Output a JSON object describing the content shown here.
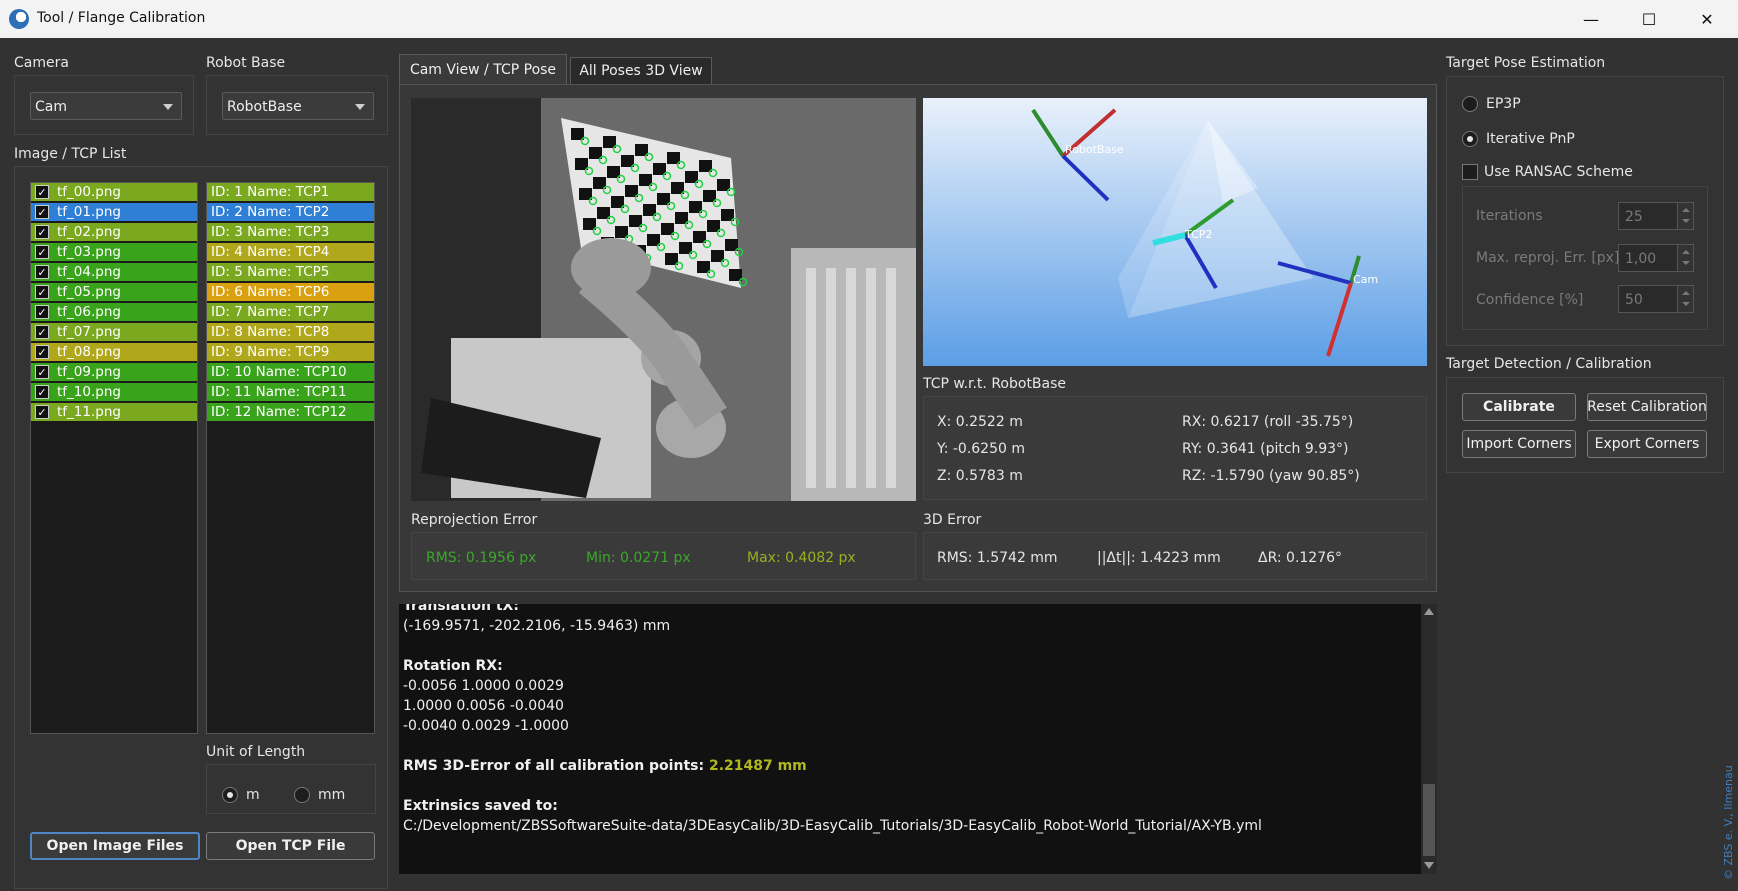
{
  "window": {
    "title": "Tool / Flange Calibration",
    "minimize": "—",
    "maximize": "☐",
    "close": "✕"
  },
  "camera": {
    "label": "Camera",
    "value": "Cam"
  },
  "robot_base": {
    "label": "Robot Base",
    "value": "RobotBase"
  },
  "image_list": {
    "label": "Image / TCP List",
    "images": [
      {
        "name": "tf_00.png",
        "checked": true,
        "color": "#7aa81e"
      },
      {
        "name": "tf_01.png",
        "checked": true,
        "color": "#2f7fd6"
      },
      {
        "name": "tf_02.png",
        "checked": true,
        "color": "#7aa81e"
      },
      {
        "name": "tf_03.png",
        "checked": true,
        "color": "#3aa31c"
      },
      {
        "name": "tf_04.png",
        "checked": true,
        "color": "#3aa31c"
      },
      {
        "name": "tf_05.png",
        "checked": true,
        "color": "#3aa31c"
      },
      {
        "name": "tf_06.png",
        "checked": true,
        "color": "#3aa31c"
      },
      {
        "name": "tf_07.png",
        "checked": true,
        "color": "#7aa81e"
      },
      {
        "name": "tf_08.png",
        "checked": true,
        "color": "#b0a81a"
      },
      {
        "name": "tf_09.png",
        "checked": true,
        "color": "#3aa31c"
      },
      {
        "name": "tf_10.png",
        "checked": true,
        "color": "#3aa31c"
      },
      {
        "name": "tf_11.png",
        "checked": true,
        "color": "#7aa81e"
      }
    ],
    "tcps": [
      {
        "name": "ID: 1 Name: TCP1",
        "color": "#7aa81e"
      },
      {
        "name": "ID: 2 Name: TCP2",
        "color": "#2f7fd6"
      },
      {
        "name": "ID: 3 Name: TCP3",
        "color": "#7aa81e"
      },
      {
        "name": "ID: 4 Name: TCP4",
        "color": "#b0a81a"
      },
      {
        "name": "ID: 5 Name: TCP5",
        "color": "#7aa81e"
      },
      {
        "name": "ID: 6 Name: TCP6",
        "color": "#d9a010"
      },
      {
        "name": "ID: 7 Name: TCP7",
        "color": "#7aa81e"
      },
      {
        "name": "ID: 8 Name: TCP8",
        "color": "#b0a81a"
      },
      {
        "name": "ID: 9 Name: TCP9",
        "color": "#b0a81a"
      },
      {
        "name": "ID: 10 Name: TCP10",
        "color": "#3aa31c"
      },
      {
        "name": "ID: 11 Name: TCP11",
        "color": "#3aa31c"
      },
      {
        "name": "ID: 12 Name: TCP12",
        "color": "#3aa31c"
      }
    ]
  },
  "unit": {
    "label": "Unit of Length",
    "opt_m": "m",
    "opt_mm": "mm",
    "selected": "m"
  },
  "buttons": {
    "open_images": "Open Image Files",
    "open_tcp": "Open TCP File",
    "calibrate": "Calibrate",
    "reset": "Reset Calibration",
    "import_corners": "Import Corners",
    "export_corners": "Export Corners"
  },
  "tabs": {
    "cam_view": "Cam View / TCP Pose",
    "all_poses": "All Poses 3D View"
  },
  "view3d": {
    "robot_base": "RobotBase",
    "tcp": "TCP2",
    "cam": "Cam"
  },
  "tcp_pose": {
    "label": "TCP w.r.t. RobotBase",
    "x": "X:  0.2522 m",
    "y": "Y: -0.6250 m",
    "z": "Z:  0.5783 m",
    "rx": "RX:  0.6217 (roll -35.75°)",
    "ry": "RY:  0.3641 (pitch 9.93°)",
    "rz": "RZ: -1.5790 (yaw 90.85°)"
  },
  "reproj": {
    "label": "Reprojection Error",
    "rms": "RMS: 0.1956 px",
    "min": "Min: 0.0271 px",
    "max": "Max: 0.4082 px"
  },
  "err3d": {
    "label": "3D Error",
    "rms": "RMS: 1.5742 mm",
    "dt": "||Δt||: 1.4223 mm",
    "dr": "ΔR: 0.1276°"
  },
  "console": {
    "line1": "Translation tX:",
    "line2": "(-169.9571, -202.2106, -15.9463) mm",
    "line3": "Rotation RX:",
    "line4": "-0.0056  1.0000  0.0029",
    "line5": "1.0000  0.0056  -0.0040",
    "line6": "-0.0040  0.0029  -1.0000",
    "line7": "RMS 3D-Error of all calibration points: ",
    "line7_val": "2.21487 mm",
    "line8": "Extrinsics saved to:",
    "line9": "C:/Development/ZBSSoftwareSuite-data/3DEasyCalib/3D-EasyCalib_Tutorials/3D-EasyCalib_Robot-World_Tutorial/AX-YB.yml"
  },
  "pose_est": {
    "label": "Target Pose Estimation",
    "ep3p": "EP3P",
    "iterative": "Iterative PnP",
    "selected": "Iterative PnP",
    "ransac": "Use RANSAC Scheme",
    "iterations_label": "Iterations",
    "iterations": "25",
    "max_err_label": "Max. reproj. Err. [px]",
    "max_err": "1,00",
    "confidence_label": "Confidence [%]",
    "confidence": "50"
  },
  "detect": {
    "label": "Target Detection / Calibration"
  },
  "watermark": "© ZBS e. V., Ilmenau"
}
